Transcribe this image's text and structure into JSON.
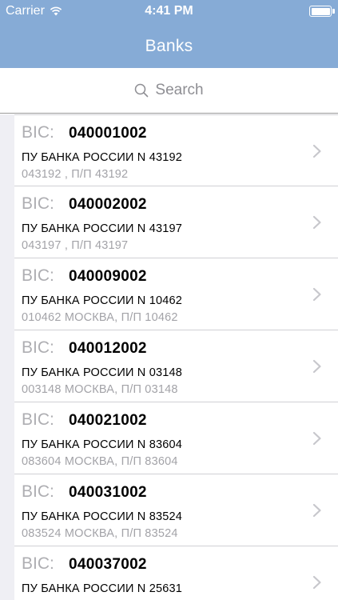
{
  "status_bar": {
    "carrier": "Carrier",
    "time": "4:41 PM",
    "battery_level": 1.0
  },
  "nav": {
    "title": "Banks"
  },
  "search": {
    "placeholder": "Search",
    "icon": "search-icon"
  },
  "colors": {
    "nav_background": "#86abd6",
    "list_background": "#efeff4",
    "secondary_text": "#a3a3a8"
  },
  "banks": [
    {
      "bic_label": "BIC:",
      "bic": "040001002",
      "name": "ПУ БАНКА РОССИИ N 43192",
      "detail": "043192 , П/П 43192"
    },
    {
      "bic_label": "BIC:",
      "bic": "040002002",
      "name": "ПУ БАНКА РОССИИ N 43197",
      "detail": "043197 , П/П 43197"
    },
    {
      "bic_label": "BIC:",
      "bic": "040009002",
      "name": "ПУ БАНКА РОССИИ N 10462",
      "detail": "010462 МОСКВА, П/П 10462"
    },
    {
      "bic_label": "BIC:",
      "bic": "040012002",
      "name": "ПУ БАНКА РОССИИ N 03148",
      "detail": "003148 МОСКВА, П/П 03148"
    },
    {
      "bic_label": "BIC:",
      "bic": "040021002",
      "name": "ПУ БАНКА РОССИИ N 83604",
      "detail": "083604 МОСКВА, П/П 83604"
    },
    {
      "bic_label": "BIC:",
      "bic": "040031002",
      "name": "ПУ БАНКА РОССИИ N 83524",
      "detail": "083524 МОСКВА, П/П 83524"
    },
    {
      "bic_label": "BIC:",
      "bic": "040037002",
      "name": "ПУ БАНКА РОССИИ N 25631",
      "detail": ""
    }
  ]
}
